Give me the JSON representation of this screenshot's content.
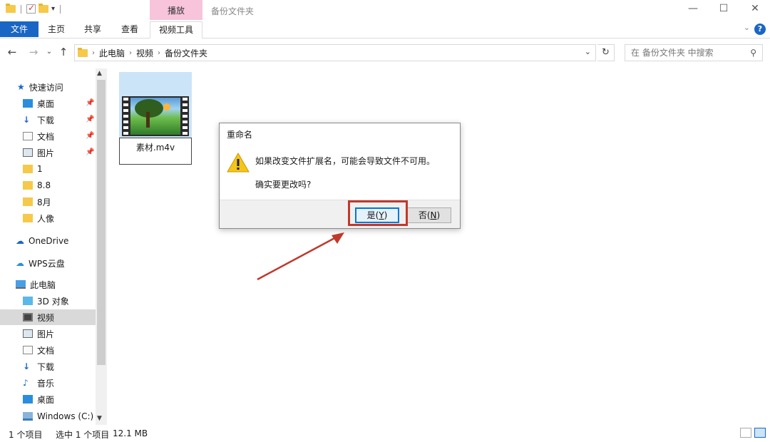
{
  "window": {
    "title": "备份文件夹",
    "context_tab_group": "播放",
    "controls": {
      "minimize": "—",
      "maximize": "☐",
      "close": "✕"
    }
  },
  "ribbon": {
    "tabs": [
      "文件",
      "主页",
      "共享",
      "查看",
      "视频工具"
    ],
    "active_tab": "视频工具",
    "help_label": "?"
  },
  "navigation": {
    "breadcrumb": [
      "此电脑",
      "视频",
      "备份文件夹"
    ],
    "search_placeholder": "在 备份文件夹 中搜索"
  },
  "sidebar": {
    "items": [
      {
        "label": "快速访问",
        "icon": "star-icon"
      },
      {
        "label": "桌面",
        "icon": "desktop-icon",
        "pinned": true
      },
      {
        "label": "下载",
        "icon": "download-icon",
        "pinned": true
      },
      {
        "label": "文档",
        "icon": "document-icon",
        "pinned": true
      },
      {
        "label": "图片",
        "icon": "picture-icon",
        "pinned": true
      },
      {
        "label": "1",
        "icon": "folder-icon"
      },
      {
        "label": "8.8",
        "icon": "folder-icon"
      },
      {
        "label": "8月",
        "icon": "folder-icon"
      },
      {
        "label": "人像",
        "icon": "folder-icon"
      },
      {
        "label": "OneDrive",
        "icon": "cloud-icon"
      },
      {
        "label": "WPS云盘",
        "icon": "cloud-icon"
      },
      {
        "label": "此电脑",
        "icon": "computer-icon"
      },
      {
        "label": "3D 对象",
        "icon": "cube-icon"
      },
      {
        "label": "视频",
        "icon": "video-icon",
        "selected": true
      },
      {
        "label": "图片",
        "icon": "picture-icon"
      },
      {
        "label": "文档",
        "icon": "document-icon"
      },
      {
        "label": "下载",
        "icon": "download-icon"
      },
      {
        "label": "音乐",
        "icon": "music-icon"
      },
      {
        "label": "桌面",
        "icon": "desktop-icon"
      },
      {
        "label": "Windows (C:)",
        "icon": "drive-icon"
      }
    ]
  },
  "content": {
    "files": [
      {
        "name": "素材.m4v",
        "type": "video",
        "selected": true,
        "renaming": true
      }
    ]
  },
  "dialog": {
    "title": "重命名",
    "message_line1": "如果改变文件扩展名，可能会导致文件不可用。",
    "message_line2": "确实要更改吗?",
    "yes_label": "是(",
    "yes_key": "Y",
    "yes_close": ")",
    "no_label": "否(",
    "no_key": "N",
    "no_close": ")"
  },
  "status_bar": {
    "item_count": "1 个项目",
    "selection": "选中 1 个项目",
    "size": "12.1 MB"
  },
  "colors": {
    "accent": "#1a66c5",
    "context_tab": "#f7c4dc",
    "annotation": "#c0392b",
    "selected_bg": "#cce4f7"
  }
}
